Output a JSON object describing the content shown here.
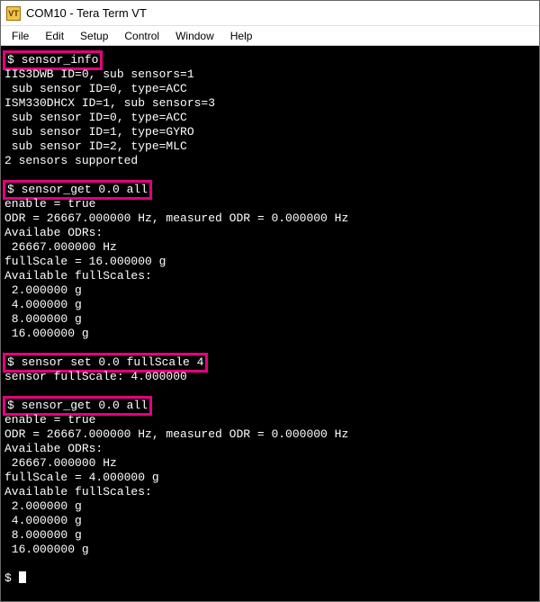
{
  "window": {
    "icon_label": "VT",
    "title": "COM10 - Tera Term VT"
  },
  "menubar": {
    "items": [
      "File",
      "Edit",
      "Setup",
      "Control",
      "Window",
      "Help"
    ]
  },
  "terminal": {
    "blocks": [
      {
        "highlighted_prompt": "$ sensor_info",
        "output": [
          "IIS3DWB ID=0, sub sensors=1",
          " sub sensor ID=0, type=ACC",
          "ISM330DHCX ID=1, sub sensors=3",
          " sub sensor ID=0, type=ACC",
          " sub sensor ID=1, type=GYRO",
          " sub sensor ID=2, type=MLC",
          "2 sensors supported",
          ""
        ]
      },
      {
        "highlighted_prompt": "$ sensor_get 0.0 all",
        "output": [
          "enable = true",
          "ODR = 26667.000000 Hz, measured ODR = 0.000000 Hz",
          "Availabe ODRs:",
          " 26667.000000 Hz",
          "fullScale = 16.000000 g",
          "Available fullScales:",
          " 2.000000 g",
          " 4.000000 g",
          " 8.000000 g",
          " 16.000000 g",
          ""
        ]
      },
      {
        "highlighted_prompt": "$ sensor set 0.0 fullScale 4",
        "output": [
          "sensor fullScale: 4.000000",
          ""
        ]
      },
      {
        "highlighted_prompt": "$ sensor_get 0.0 all",
        "output": [
          "enable = true",
          "ODR = 26667.000000 Hz, measured ODR = 0.000000 Hz",
          "Availabe ODRs:",
          " 26667.000000 Hz",
          "fullScale = 4.000000 g",
          "Available fullScales:",
          " 2.000000 g",
          " 4.000000 g",
          " 8.000000 g",
          " 16.000000 g",
          ""
        ]
      }
    ],
    "final_prompt": "$ "
  }
}
